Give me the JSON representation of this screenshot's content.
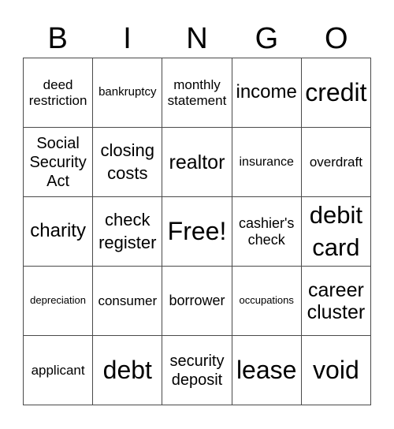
{
  "header": {
    "letters": [
      "B",
      "I",
      "N",
      "G",
      "O"
    ]
  },
  "card": {
    "rows": [
      [
        "deed\nrestriction",
        "bankruptcy",
        "monthly\nstatement",
        "income",
        "credit"
      ],
      [
        "Social\nSecurity\nAct",
        "closing\ncosts",
        "realtor",
        "insurance",
        "overdraft"
      ],
      [
        "charity",
        "check\nregister",
        "Free!",
        "cashier's\ncheck",
        "debit\ncard"
      ],
      [
        "depreciation",
        "consumer",
        "borrower",
        "occupations",
        "career\ncluster"
      ],
      [
        "applicant",
        "debt",
        "security\ndeposit",
        "lease",
        "void"
      ]
    ],
    "free_space": "Free!"
  },
  "colors": {
    "border": "#4a4a4a",
    "text": "#000000",
    "background": "#ffffff"
  }
}
